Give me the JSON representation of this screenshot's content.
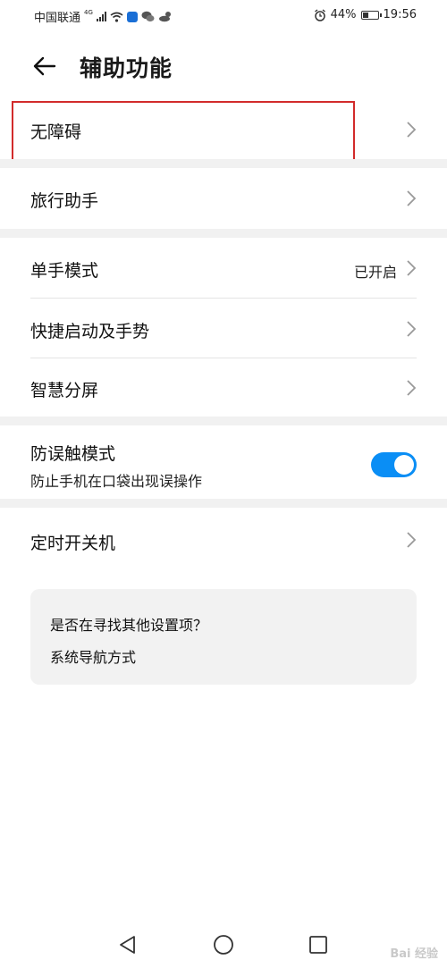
{
  "status_bar": {
    "carrier": "中国联通",
    "network": "4G",
    "battery_text": "44%",
    "battery_level": 0.44,
    "time": "19:56"
  },
  "header": {
    "title": "辅助功能"
  },
  "items": {
    "accessibility": "无障碍",
    "travel_assistant": "旅行助手",
    "one_hand_mode": "单手模式",
    "one_hand_status": "已开启",
    "shortcuts_gestures": "快捷启动及手势",
    "smart_split": "智慧分屏",
    "mistouch_title": "防误触模式",
    "mistouch_desc": "防止手机在口袋出现误操作",
    "mistouch_enabled": true,
    "scheduled_power": "定时开关机"
  },
  "suggestion": {
    "question": "是否在寻找其他设置项？",
    "link": "系统导航方式"
  },
  "watermark": "Bai 经验",
  "colors": {
    "accent": "#0a8ef5",
    "highlight": "#d22b2b",
    "section_gap": "#f1f1f1",
    "card_bg": "#f2f2f2"
  }
}
